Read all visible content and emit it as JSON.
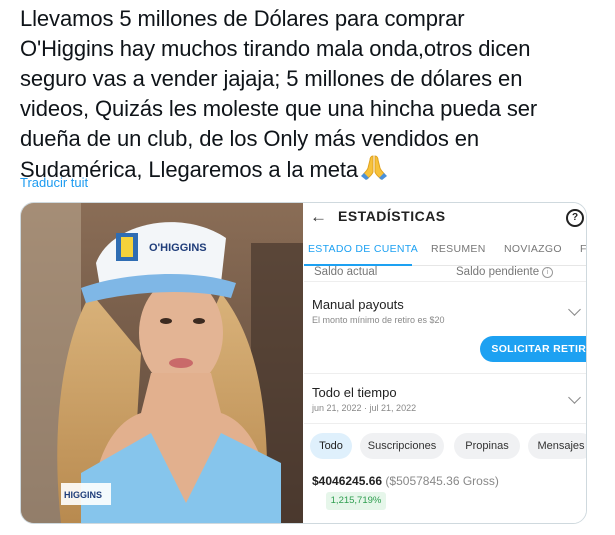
{
  "tweet": {
    "text_lines": [
      "Llevamos 5 millones de Dólares para comprar",
      "O'Higgins hay muchos tirando mala onda,otros dicen",
      "seguro vas a vender jajaja; 5 millones de dólares en",
      "videos, Quizás les moleste que una hincha pueda ser",
      "dueña de un club, de los Only más vendidos en",
      "Sudamérica, Llegaremos a la meta"
    ],
    "emoji": "folded-hands-emoji",
    "translate_label": "Traducir tuit"
  },
  "photo": {
    "cap_text": "O'HIGGINS",
    "shirt_text": "HIGGINS",
    "description_icon": "photo"
  },
  "stats": {
    "header_title": "ESTADÍSTICAS",
    "back_icon": "arrow-left-icon",
    "help_icon": "question-circle-icon",
    "tabs": [
      {
        "label": "ESTADO DE CUENTA",
        "active": true
      },
      {
        "label": "RESUMEN",
        "active": false
      },
      {
        "label": "NOVIAZGO",
        "active": false
      },
      {
        "label": "F",
        "active": false
      }
    ],
    "saldo_actual": "Saldo actual",
    "saldo_pendiente": "Saldo pendiente",
    "payouts_title": "Manual payouts",
    "payouts_sub": "El monto mínimo de retiro es $20",
    "retiro_button": "SOLICITAR RETIRO",
    "period_title": "Todo el tiempo",
    "period_range": "jun 21, 2022 · jul 21, 2022",
    "chips": [
      {
        "label": "Todo",
        "active": true
      },
      {
        "label": "Suscripciones",
        "active": false
      },
      {
        "label": "Propinas",
        "active": false
      },
      {
        "label": "Mensajes",
        "active": false
      }
    ],
    "net_amount": "$4046245.66",
    "gross_amount": "($5057845.36 Gross)",
    "growth_badge": "1,215,719%",
    "accent_color": "#1da1f2"
  }
}
